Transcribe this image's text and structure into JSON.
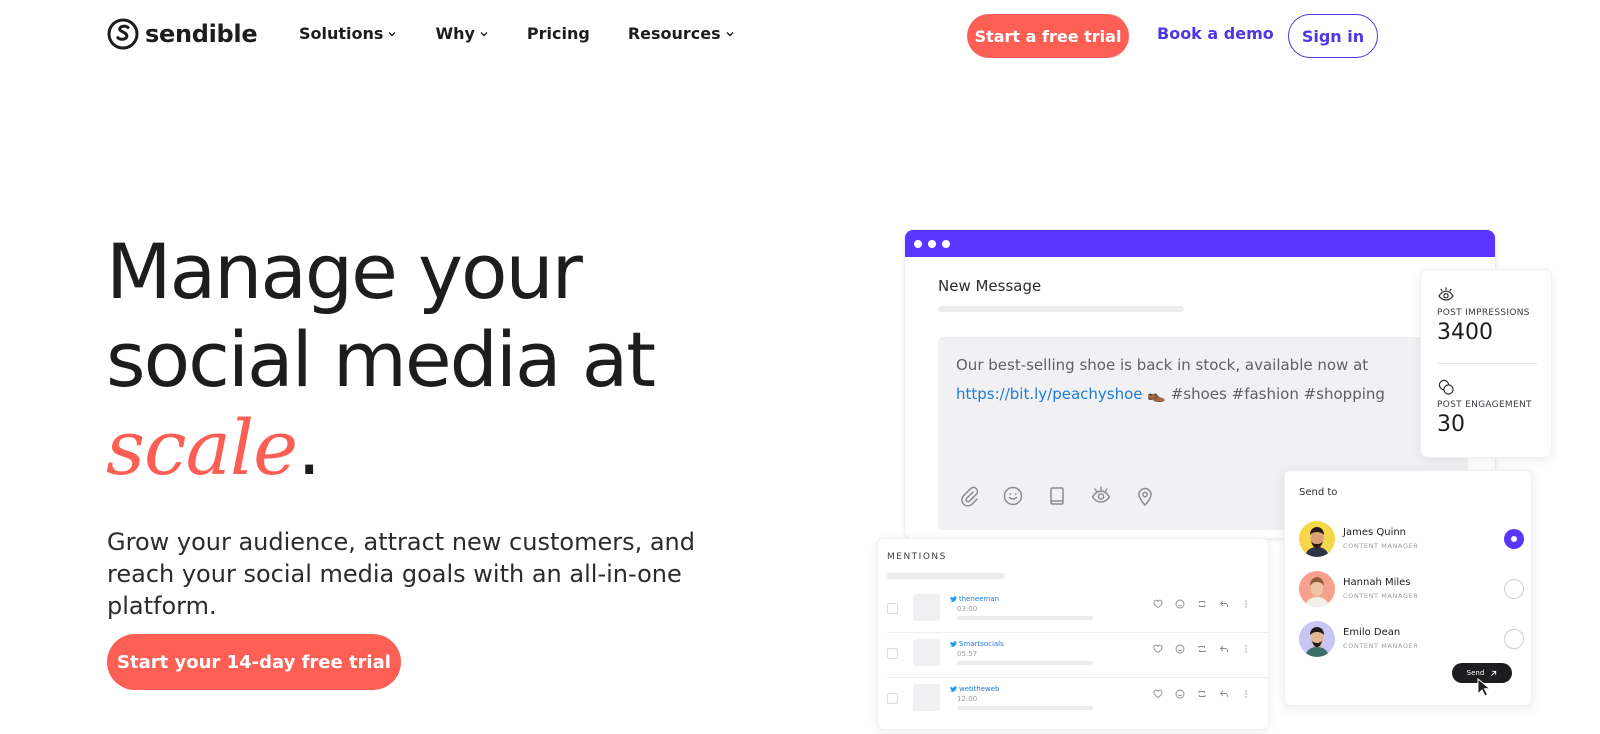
{
  "nav": {
    "logo_text": "sendible",
    "links": [
      {
        "label": "Solutions",
        "has_dropdown": true
      },
      {
        "label": "Why",
        "has_dropdown": true
      },
      {
        "label": "Pricing",
        "has_dropdown": false
      },
      {
        "label": "Resources",
        "has_dropdown": true
      }
    ],
    "cta_trial": "Start a free trial",
    "cta_demo": "Book a demo",
    "cta_signin": "Sign in"
  },
  "hero": {
    "title_line1": "Manage your",
    "title_line2": "social media at",
    "title_accent": "scale",
    "title_period": ".",
    "subtitle": "Grow your audience, attract new customers, and reach your social media goals with an all-in-one platform.",
    "cta": "Start your 14-day free trial"
  },
  "composer": {
    "title": "New Message",
    "text_before": "Our best-selling shoe is back in stock, available now at",
    "link": "https://bit.ly/peachyshoe",
    "text_after": "👞 #shoes #fashion #shopping",
    "tools": [
      "paperclip-icon",
      "emoji-icon",
      "book-icon",
      "eye-icon",
      "location-pin-icon"
    ]
  },
  "stats": {
    "impressions_label": "POST IMPRESSIONS",
    "impressions_value": "3400",
    "engagement_label": "POST ENGAGEMENT",
    "engagement_value": "30"
  },
  "mentions": {
    "title": "MENTIONS",
    "rows": [
      {
        "handle": "theneeman",
        "time": "03:00"
      },
      {
        "handle": "Smartsocials",
        "time": "05:57"
      },
      {
        "handle": "webtheweb",
        "time": "12:00"
      }
    ]
  },
  "sendto": {
    "title": "Send to",
    "people": [
      {
        "name": "James Quinn",
        "role": "CONTENT MANAGER",
        "selected": true
      },
      {
        "name": "Hannah Miles",
        "role": "CONTENT MANAGER",
        "selected": false
      },
      {
        "name": "Emilo Dean",
        "role": "CONTENT MANAGER",
        "selected": false
      }
    ],
    "send_label": "Send"
  },
  "colors": {
    "brand_coral": "#fe5f55",
    "brand_purple": "#4d37e5",
    "card_purple": "#5a35ff",
    "text_dark": "#1d1d1f"
  }
}
